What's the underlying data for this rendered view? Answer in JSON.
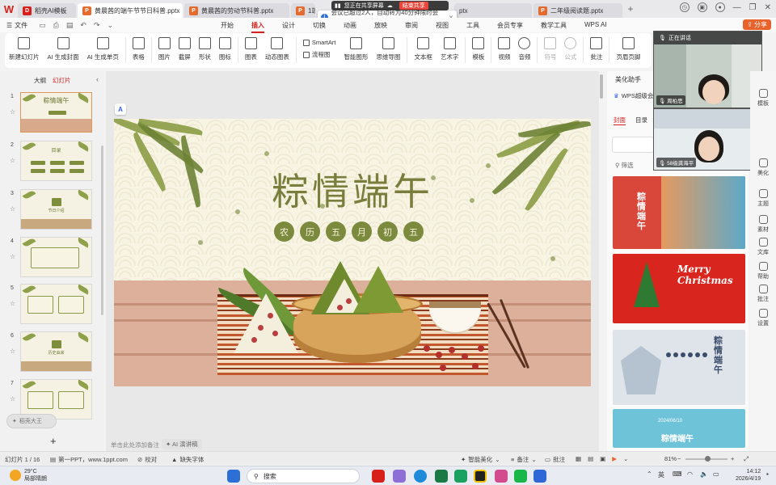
{
  "tabs": {
    "home": "稻壳AI模板",
    "docs": [
      {
        "label": "黄晨茜的端午节节日科普.pptx",
        "active": true
      },
      {
        "label": "黄晨茜的劳动节科普.pptx",
        "active": false
      },
      {
        "label": "1端午",
        "active": false
      },
      {
        "label": "ptx",
        "active": false
      },
      {
        "label": "二年级阅读题.pptx",
        "active": false
      }
    ]
  },
  "share": {
    "banner": "您正在共享屏幕",
    "end": "结束共享",
    "notice": "会议已超过2人，自动转为40分钟限时会议。"
  },
  "menubar": {
    "file": "文件",
    "items": [
      "开始",
      "插入",
      "设计",
      "切换",
      "动画",
      "放映",
      "审阅",
      "视图",
      "工具",
      "会员专享",
      "教学工具",
      "WPS AI"
    ],
    "active": "插入",
    "share_btn": "分享"
  },
  "ribbon": {
    "items": [
      "新建幻灯片",
      "AI 生成封面",
      "AI 生成单页",
      "表格",
      "图片",
      "截屏",
      "形状",
      "图标",
      "图表",
      "动态图表",
      "智能图形",
      "思维导图",
      "文本框",
      "艺术字",
      "模板",
      "视频",
      "音频",
      "符号",
      "公式",
      "批注",
      "页眉页脚"
    ],
    "smartart": "SmartArt",
    "flowchart": "流程图"
  },
  "leftpanel": {
    "tab_outline": "大纲",
    "tab_slides": "幻灯片",
    "chip": "稻壳大王",
    "thumbs": [
      {
        "num": "1",
        "title": "粽情端午"
      },
      {
        "num": "2",
        "title": "目录"
      },
      {
        "num": "3",
        "title": "节日介绍"
      },
      {
        "num": "4",
        "title": ""
      },
      {
        "num": "5",
        "title": ""
      },
      {
        "num": "6",
        "title": "历史由来"
      },
      {
        "num": "7",
        "title": ""
      }
    ]
  },
  "slide": {
    "title": "粽情端午",
    "subtitle_chars": [
      "农",
      "历",
      "五",
      "月",
      "初",
      "五"
    ]
  },
  "canvas": {
    "note_placeholder": "单击此处添加备注",
    "ai_note": "AI 演讲稿"
  },
  "rightpanel": {
    "title": "美化助手",
    "wps": "WPS超级会员",
    "tab_cover": "封面",
    "tab_toc": "目录",
    "filter": "筛选",
    "templates": [
      {
        "text": "粽情端午",
        "bg": "#d9473b"
      },
      {
        "text": "Merry Christmas",
        "bg": "#d8261f"
      },
      {
        "text": "粽情端午",
        "bg": "#dfe4ea"
      },
      {
        "text": "粽情端午",
        "sub": "2024/06/10",
        "bg": "#6fc3d9"
      }
    ]
  },
  "video": {
    "speaking": "正在讲话",
    "p1": "周柏思",
    "p2": "58级龚海平"
  },
  "farright": [
    "模板",
    "美化",
    "主题",
    "素材",
    "文库",
    "帮助",
    "批注",
    "设置"
  ],
  "status": {
    "slide_count": "幻灯片 1 / 16",
    "theme": "第一PPT，www.1ppt.com",
    "proof": "校对",
    "missing_font": "缺失字体",
    "smart_beautify": "智能美化",
    "notes": "备注",
    "comments": "批注",
    "zoom": "81%"
  },
  "taskbar": {
    "weather_temp": "29°C",
    "weather_desc": "局部晴朗",
    "search": "搜索",
    "ime": "英",
    "time": "14:12",
    "date": "2026/4/19"
  },
  "colors": {
    "accent": "#d7201b",
    "slide_green": "#7b8a3c",
    "slide_bg": "#f8f4e3"
  }
}
